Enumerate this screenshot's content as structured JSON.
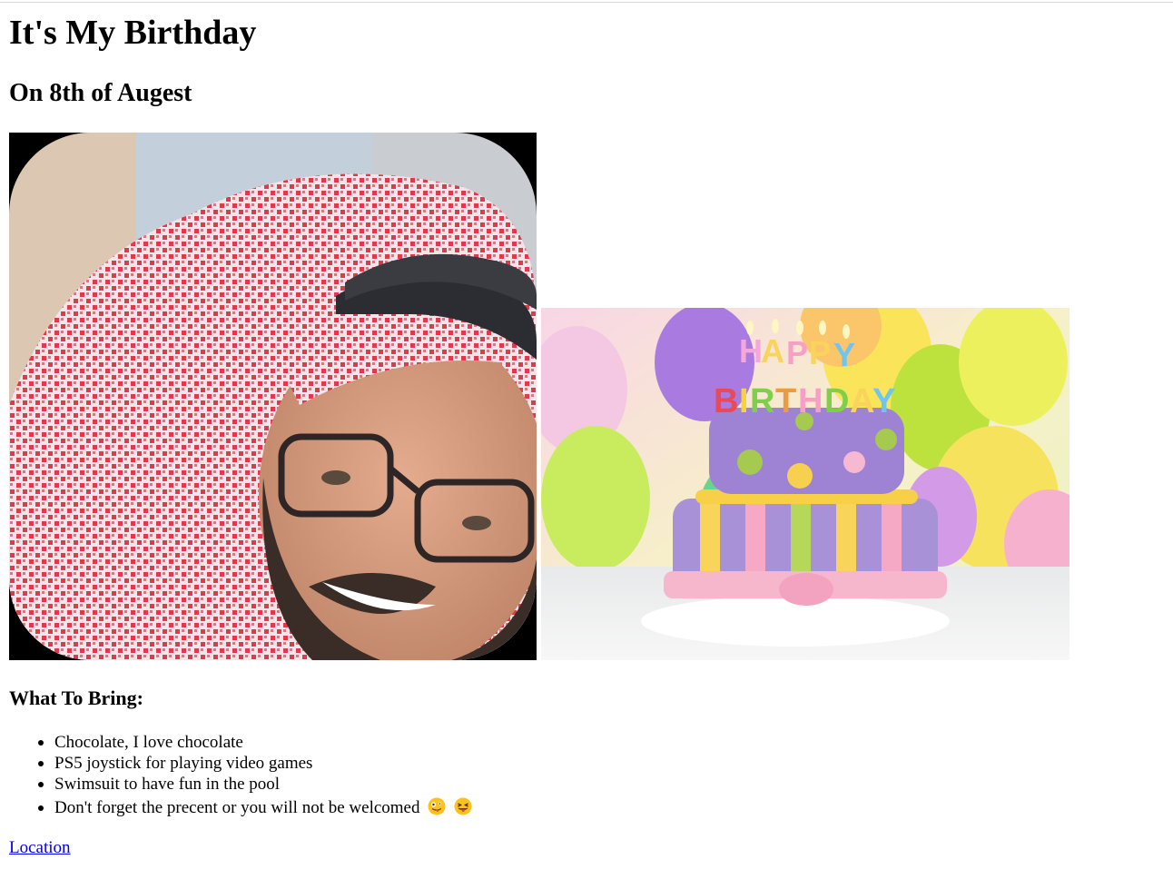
{
  "page": {
    "title": "It's My Birthday",
    "subtitle": "On 8th of Augest"
  },
  "images": {
    "portrait_alt": "portrait photo",
    "cake_alt": "birthday cake with balloons",
    "cake_candles_text": "HAPPY BIRTHDAY"
  },
  "bring": {
    "heading": "What To Bring:",
    "items": [
      "Chocolate, I love chocolate",
      "PS5 joystick for playing video games",
      "Swimsuit to have fun in the pool",
      "Don't forget the precent or you will not be welcomed"
    ],
    "last_item_emojis": [
      "zany-face-emoji",
      "tongue-out-face-emoji"
    ]
  },
  "link": {
    "label": "Location"
  },
  "colors": {
    "link": "#0000ee",
    "shemagh_red": "#e0394b",
    "cake_purple": "#9b7fd0"
  }
}
